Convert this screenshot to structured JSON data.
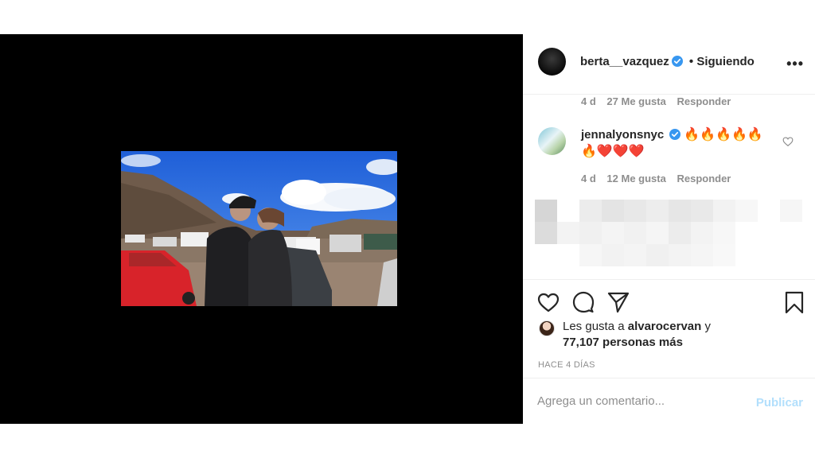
{
  "post": {
    "author": {
      "username": "berta__vazquez",
      "verified": true,
      "separator": "•",
      "follow_status": "Siguiendo"
    },
    "more_label": "•••"
  },
  "comments": [
    {
      "time": "4 d",
      "likes": "27 Me gusta",
      "reply": "Responder"
    },
    {
      "username": "jennalyonsnyc",
      "verified": true,
      "text": "🔥🔥🔥🔥🔥🔥❤️❤️❤️",
      "time": "4 d",
      "likes": "12 Me gusta",
      "reply": "Responder"
    }
  ],
  "likes": {
    "prefix": "Les gusta a",
    "user": "alvarocervan",
    "join": "y",
    "count": "77,107 personas más"
  },
  "time_ago": "HACE 4 DÍAS",
  "comment_box": {
    "placeholder": "Agrega un comentario...",
    "publish": "Publicar"
  },
  "colors": {
    "accent_blue": "#3897f0",
    "publish_disabled": "#b2dffc",
    "verified": "#3897f0"
  },
  "icons": [
    "heart-icon",
    "comment-icon",
    "share-icon",
    "bookmark-icon",
    "more-icon",
    "verified-icon"
  ]
}
